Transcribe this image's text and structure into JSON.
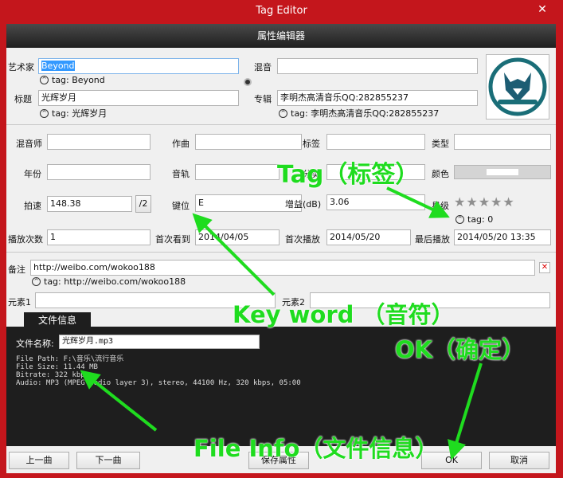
{
  "window": {
    "title": "Tag Editor",
    "close_icon": "close-icon"
  },
  "header": {
    "title": "属性编辑器"
  },
  "fields": {
    "artist_label": "艺术家",
    "artist_value": "Beyond",
    "artist_tag": "tag: Beyond",
    "mixing_label": "混音",
    "mixing_value": "",
    "title_label": "标题",
    "title_value": "光辉岁月",
    "title_tag": "tag: 光辉岁月",
    "album_label": "专辑",
    "album_value": "李明杰高清音乐QQ:282855237",
    "album_tag": "tag: 李明杰高清音乐QQ:282855237",
    "remixer_label": "混音师",
    "remixer_value": "",
    "composer_label": "作曲",
    "composer_value": "",
    "label_label": "标签",
    "label_value": "",
    "genre_label": "类型",
    "genre_value": "",
    "year_label": "年份",
    "year_value": "",
    "track_label": "音轨",
    "track_value": "",
    "disc_label": "分类",
    "disc_value": "",
    "color_label": "颜色",
    "bpm_label": "拍速",
    "bpm_value": "148.38",
    "bpm_half": "/2",
    "key_label": "键位",
    "key_value": "E",
    "gain_label": "增益(dB)",
    "gain_value": "3.06",
    "rating_label": "星级",
    "rating_tag": "tag: 0",
    "playcount_label": "播放次数",
    "playcount_value": "1",
    "firstseen_label": "首次看到",
    "firstseen_value": "2014/04/05",
    "firstplay_label": "首次播放",
    "firstplay_value": "2014/05/20",
    "lastplay_label": "最后播放",
    "lastplay_value": "2014/05/20 13:35",
    "comment_label": "备注",
    "comment_value": "http://weibo.com/wokoo188",
    "comment_tag": "tag: http://weibo.com/wokoo188",
    "element1_label": "元素1",
    "element1_value": "",
    "element2_label": "元素2",
    "element2_value": ""
  },
  "rating": {
    "stars": 5,
    "value": 0
  },
  "fileinfo": {
    "tab_label": "文件信息",
    "filename_label": "文件名称:",
    "filename_value": "光辉岁月.mp3",
    "path_line": "File Path: F:\\音乐\\流行音乐",
    "size_line": "File Size: 11.44 MB",
    "bitrate_line": "Bitrate: 322 kbps",
    "audio_line": "Audio: MP3 (MPEG audio layer 3), stereo, 44100 Hz, 320 kbps, 05:00"
  },
  "buttons": {
    "prev": "上一曲",
    "next": "下一曲",
    "save": "保存属性",
    "ok": "OK",
    "cancel": "取消"
  },
  "annotations": {
    "tag": "Tag（标签）",
    "keyword": "Key word （音符）",
    "ok": "OK（确定）",
    "fileinfo": "File Info（文件信息）"
  },
  "colors": {
    "accent": "#c4161c",
    "annotation": "#1fdc1f",
    "selection": "#3399ff"
  }
}
